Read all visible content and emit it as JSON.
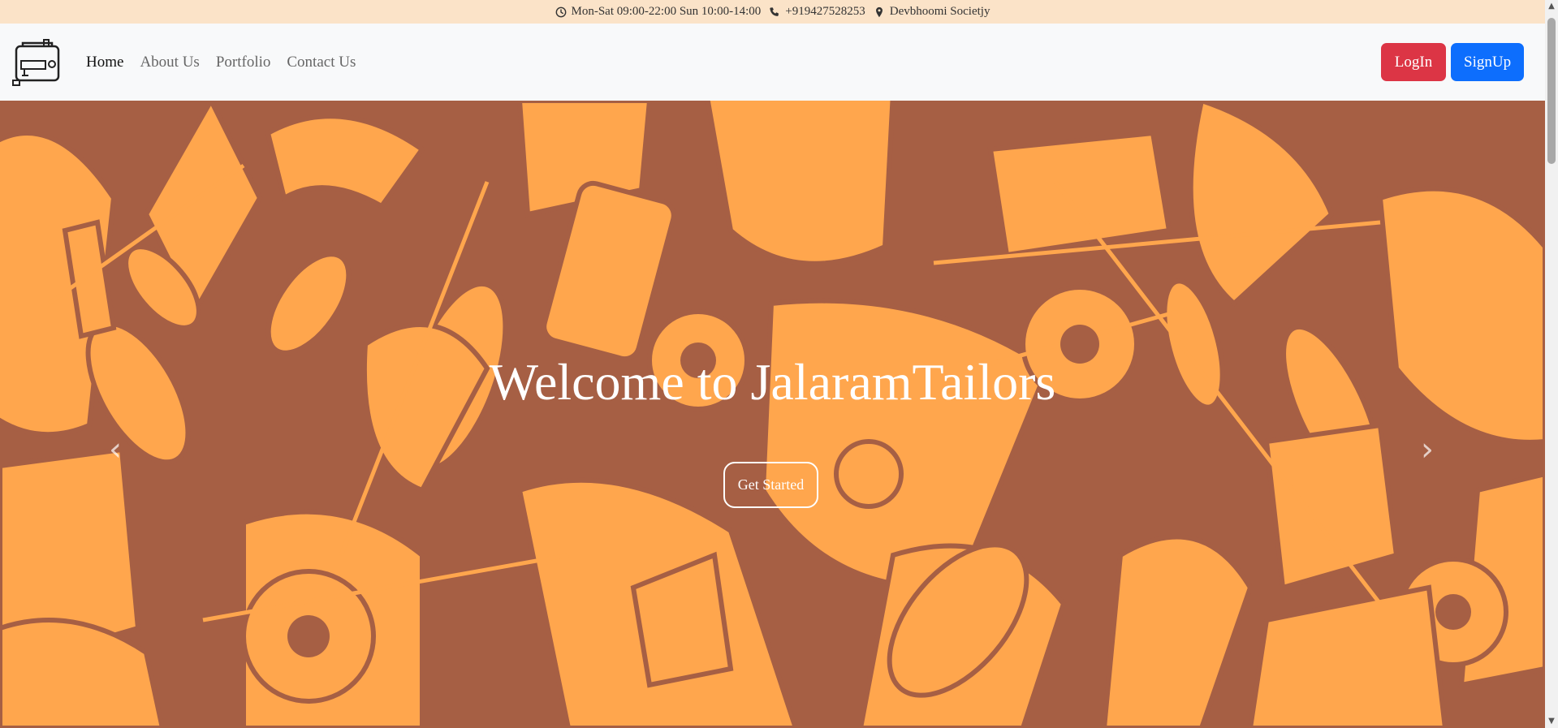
{
  "topbar": {
    "hours": "Mon-Sat 09:00-22:00 Sun 10:00-14:00",
    "phone": "+919427528253",
    "address": "Devbhoomi Societjy",
    "background": "#fbe3c8"
  },
  "navbar": {
    "links": [
      {
        "label": "Home",
        "active": true
      },
      {
        "label": "About Us",
        "active": false
      },
      {
        "label": "Portfolio",
        "active": false
      },
      {
        "label": "Contact Us",
        "active": false
      }
    ],
    "login_label": "LogIn",
    "signup_label": "SignUp",
    "login_color": "#dc3545",
    "signup_color": "#0d6efd"
  },
  "hero": {
    "title": "Welcome to JalaramTailors",
    "button_label": "Get Started",
    "bg_color": "#a65f44",
    "pattern_color": "#ffa64d",
    "prev_icon": "chevron-left-icon",
    "next_icon": "chevron-right-icon"
  },
  "scrollbar": {
    "up_icon": "▲",
    "down_icon": "▼"
  }
}
